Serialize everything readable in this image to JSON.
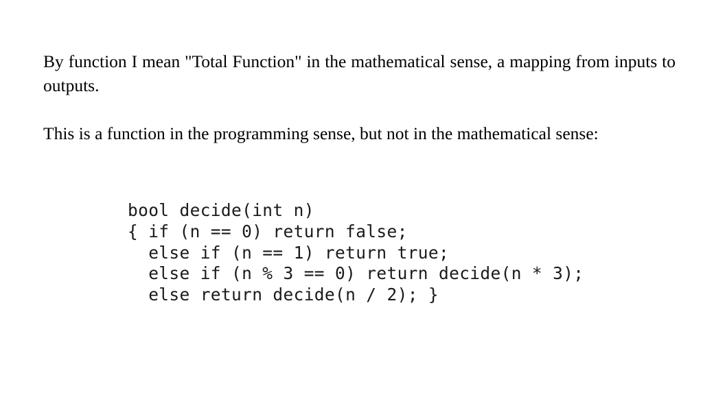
{
  "slide": {
    "background_color": "#ffffff",
    "text_color": "#000000",
    "code_color": "#1a1a1a",
    "paragraphs": [
      "By function I mean \"Total Function\" in the mathematical sense, a mapping from inputs to outputs.",
      "This is a function in the programming sense, but not in the mathematical sense:"
    ],
    "code": {
      "language": "cpp",
      "lines": [
        "bool decide(int n)",
        "{ if (n == 0) return false;",
        "  else if (n == 1) return true;",
        "  else if (n % 3 == 0) return decide(n * 3);",
        "  else return decide(n / 2); }"
      ]
    }
  }
}
